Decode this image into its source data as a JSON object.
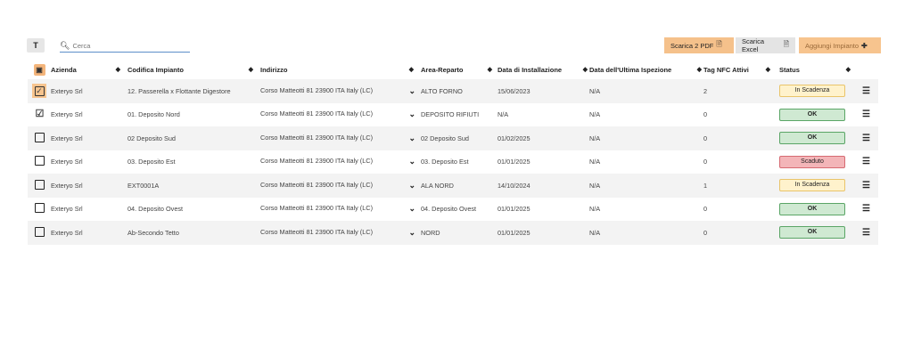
{
  "toolbar": {
    "search_placeholder": "Cerca",
    "pdf_label": "Scarica 2 PDF",
    "excel_label": "Scarica Excel",
    "add_label": "Aggiungi Impianto"
  },
  "columns": {
    "azienda": "Azienda",
    "codifica": "Codifica Impianto",
    "indirizzo": "Indirizzo",
    "area": "Area-Reparto",
    "data_install": "Data di Installazione",
    "data_ispezione": "Data dell'Ultima Ispezione",
    "tag_nfc": "Tag NFC Attivi",
    "status": "Status"
  },
  "rows": [
    {
      "azienda": "Exteryo Srl",
      "codifica": "12. Passerella x Flottante Digestore",
      "indirizzo": "Corso Matteotti 81 23900 ITA Italy (LC)",
      "area": "ALTO FORNO",
      "data_install": "15/06/2023",
      "data_ispezione": "N/A",
      "tag": "2",
      "status": "In Scadenza",
      "status_type": "warn",
      "checked": true
    },
    {
      "azienda": "Exteryo Srl",
      "codifica": "01. Deposito Nord",
      "indirizzo": "Corso Matteotti 81 23900 ITA Italy (LC)",
      "area": "DEPOSITO RIFIUTI",
      "data_install": "N/A",
      "data_ispezione": "N/A",
      "tag": "0",
      "status": "OK",
      "status_type": "ok",
      "checked": true
    },
    {
      "azienda": "Exteryo Srl",
      "codifica": "02 Deposito Sud",
      "indirizzo": "Corso Matteotti 81 23900 ITA Italy (LC)",
      "area": "02 Deposito Sud",
      "data_install": "01/02/2025",
      "data_ispezione": "N/A",
      "tag": "0",
      "status": "OK",
      "status_type": "ok",
      "checked": false
    },
    {
      "azienda": "Exteryo Srl",
      "codifica": "03. Deposito Est",
      "indirizzo": "Corso Matteotti 81 23900 ITA Italy (LC)",
      "area": "03. Deposito Est",
      "data_install": "01/01/2025",
      "data_ispezione": "N/A",
      "tag": "0",
      "status": "Scaduto",
      "status_type": "exp",
      "checked": false
    },
    {
      "azienda": "Exteryo Srl",
      "codifica": "EXT0001A",
      "indirizzo": "Corso Matteotti 81 23900 ITA Italy (LC)",
      "area": "ALA NORD",
      "data_install": "14/10/2024",
      "data_ispezione": "N/A",
      "tag": "1",
      "status": "In Scadenza",
      "status_type": "warn",
      "checked": false
    },
    {
      "azienda": "Exteryo Srl",
      "codifica": "04. Deposito Ovest",
      "indirizzo": "Corso Matteotti 81 23900 ITA Italy (LC)",
      "area": "04. Deposito Ovest",
      "data_install": "01/01/2025",
      "data_ispezione": "N/A",
      "tag": "0",
      "status": "OK",
      "status_type": "ok",
      "checked": false
    },
    {
      "azienda": "Exteryo Srl",
      "codifica": "Ab-Secondo Tetto",
      "indirizzo": "Corso Matteotti 81 23900 ITA Italy (LC)",
      "area": "NORD",
      "data_install": "01/01/2025",
      "data_ispezione": "N/A",
      "tag": "0",
      "status": "OK",
      "status_type": "ok",
      "checked": false
    }
  ]
}
